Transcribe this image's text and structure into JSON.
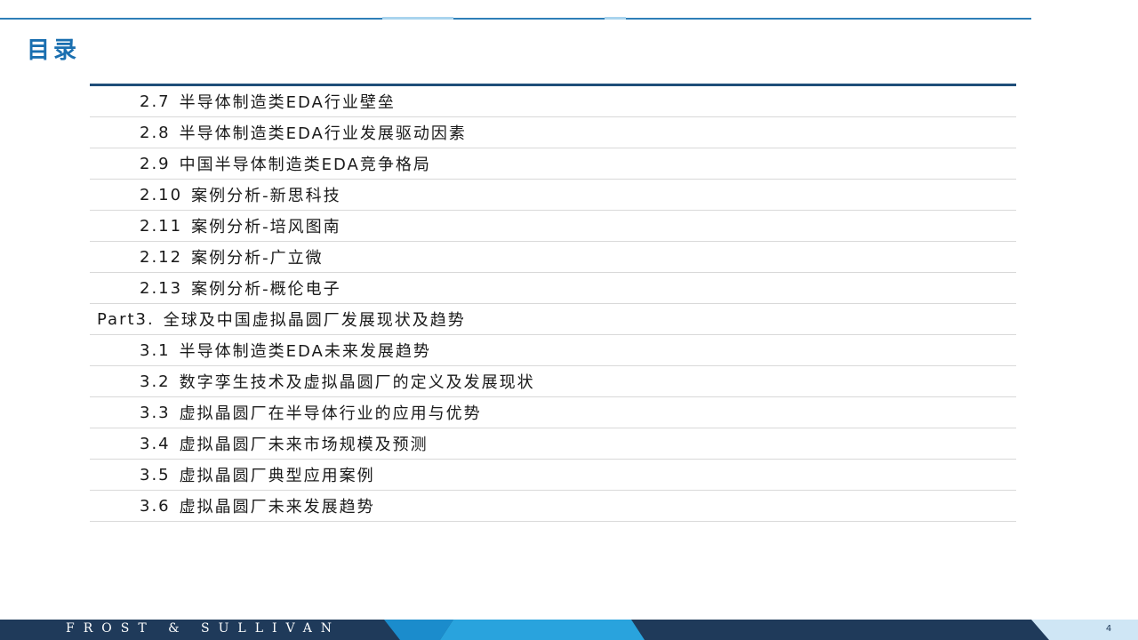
{
  "header": {
    "title": "目录"
  },
  "toc": {
    "items": [
      {
        "num": "2.7",
        "text": "半导体制造类EDA行业壁垒",
        "level": "sub"
      },
      {
        "num": "2.8",
        "text": "半导体制造类EDA行业发展驱动因素",
        "level": "sub"
      },
      {
        "num": "2.9",
        "text": "中国半导体制造类EDA竞争格局",
        "level": "sub"
      },
      {
        "num": "2.10",
        "text": "案例分析-新思科技",
        "level": "sub"
      },
      {
        "num": "2.11",
        "text": "案例分析-培风图南",
        "level": "sub"
      },
      {
        "num": "2.12",
        "text": "案例分析-广立微",
        "level": "sub"
      },
      {
        "num": "2.13",
        "text": "案例分析-概伦电子",
        "level": "sub"
      },
      {
        "num": "Part3.",
        "text": "全球及中国虚拟晶圆厂发展现状及趋势",
        "level": "part"
      },
      {
        "num": "3.1",
        "text": "半导体制造类EDA未来发展趋势",
        "level": "sub"
      },
      {
        "num": "3.2",
        "text": "数字孪生技术及虚拟晶圆厂的定义及发展现状",
        "level": "sub"
      },
      {
        "num": "3.3",
        "text": "虚拟晶圆厂在半导体行业的应用与优势",
        "level": "sub"
      },
      {
        "num": "3.4",
        "text": "虚拟晶圆厂未来市场规模及预测",
        "level": "sub"
      },
      {
        "num": "3.5",
        "text": "虚拟晶圆厂典型应用案例",
        "level": "sub"
      },
      {
        "num": "3.6",
        "text": "虚拟晶圆厂未来发展趋势",
        "level": "sub"
      }
    ]
  },
  "footer": {
    "brand": "FROST & SULLIVAN",
    "page_number": "4"
  },
  "colors": {
    "title": "#1a6fb0",
    "rule_dark": "#1f4e79",
    "footer_dark": "#1f3a5a",
    "footer_blue": "#29a3dd",
    "footer_light": "#cfe6f5"
  }
}
